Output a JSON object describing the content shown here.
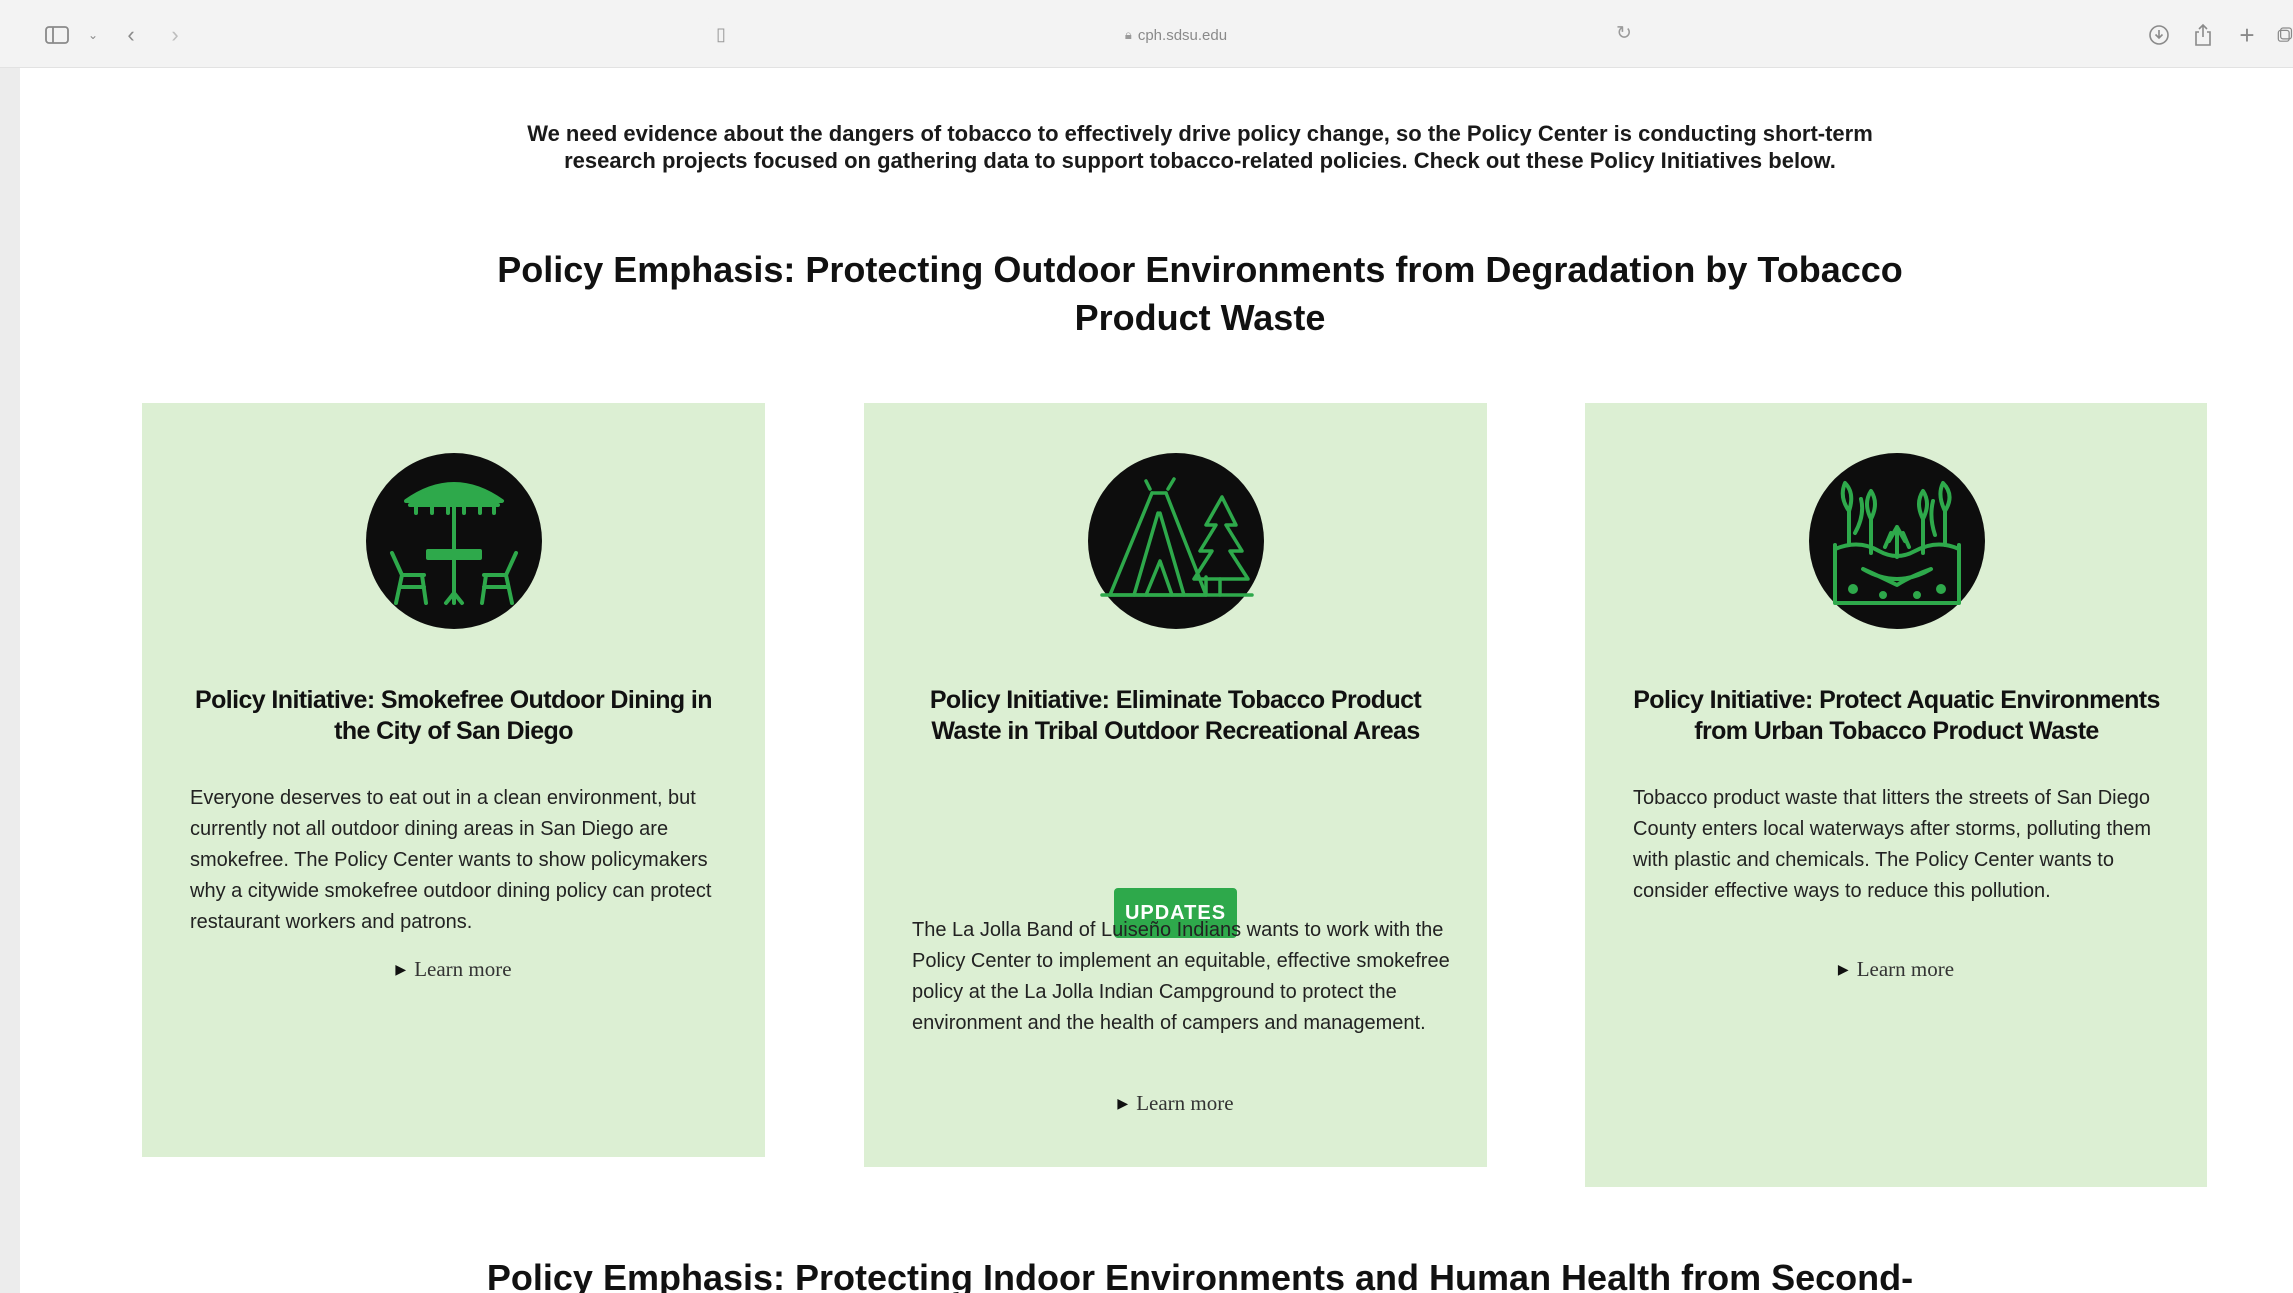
{
  "browser": {
    "url": "cph.sdsu.edu",
    "icons": [
      "sidebar-icon",
      "chevron-down-icon",
      "back-icon",
      "forward-icon",
      "reader-icon",
      "lock-icon",
      "reload-icon",
      "download-icon",
      "share-icon",
      "new-tab-icon",
      "tab-overview-icon"
    ]
  },
  "intro": {
    "line1": "We need evidence about the dangers of tobacco to effectively drive policy change, so the Policy Center is conducting short-term",
    "line2": "research projects focused on gathering data to support tobacco-related policies. Check out these Policy Initiatives below."
  },
  "section1": {
    "heading": "Policy Emphasis: Protecting Outdoor Environments from Degradation by Tobacco Product Waste"
  },
  "cards": [
    {
      "icon": "outdoor-dining-icon",
      "title": "Policy Initiative: Smokefree Outdoor Dining in the City of San Diego",
      "body": "Everyone deserves to eat out in a clean environment, but currently not all outdoor dining areas in San Diego are smokefree. The Policy Center wants to show policymakers why a citywide smokefree outdoor dining policy can protect restaurant workers and patrons.",
      "learn_more": "Learn more"
    },
    {
      "icon": "campground-tent-icon",
      "title": "Policy Initiative: Eliminate Tobacco Product Waste in Tribal Outdoor Recreational Areas",
      "button": "UPDATES",
      "body": "The La Jolla Band of Luiseño Indians wants to work with the Policy Center to implement an equitable, effective smokefree policy at the La Jolla Indian Campground to protect the environment and the health of campers and management.",
      "learn_more": "Learn more"
    },
    {
      "icon": "aquatic-environment-icon",
      "title": "Policy Initiative: Protect Aquatic Environments from Urban Tobacco Product Waste",
      "body": "Tobacco product waste that litters the streets of San Diego County enters local waterways after storms, polluting them with plastic and chemicals. The Policy Center wants to consider effective ways to reduce this pollution.",
      "learn_more": "Learn more"
    }
  ],
  "section2": {
    "heading": "Policy Emphasis: Protecting Indoor Environments and Human Health from Second-"
  },
  "colors": {
    "card_bg": "#dcefd3",
    "icon_green": "#2ea94b",
    "button_bg": "#2ea94b"
  }
}
